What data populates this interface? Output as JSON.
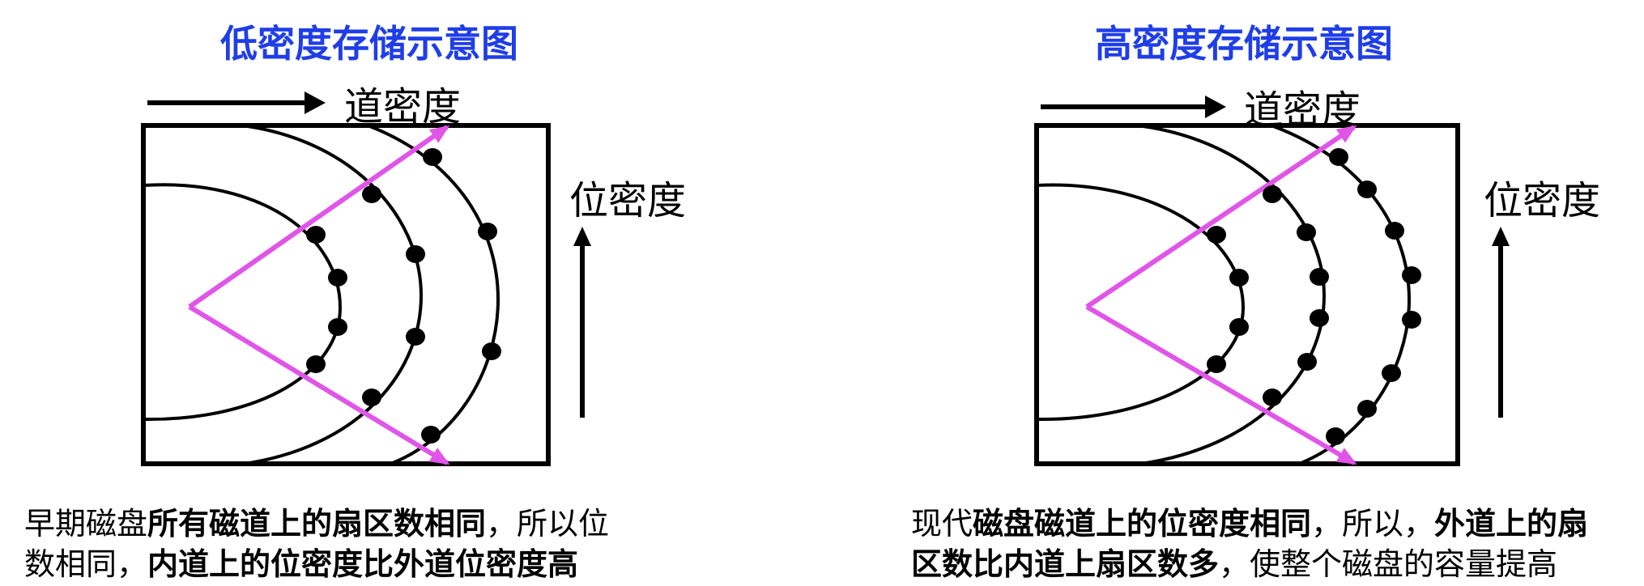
{
  "left": {
    "title": "低密度存储示意图",
    "track_density_label": "道密度",
    "bit_density_label": "位密度",
    "caption": {
      "line1_normal_a": "早期磁盘",
      "line1_bold": "所有磁道上的扇区数相同",
      "line1_normal_b": "，所以位",
      "line2_normal_a": "数相同，",
      "line2_bold": "内道上的位密度比外道位密度高"
    }
  },
  "right": {
    "title": "高密度存储示意图",
    "track_density_label": "道密度",
    "bit_density_label": "位密度",
    "caption": {
      "line1_normal_a": "现代",
      "line1_bold_a": "磁盘磁道上的位密度相同",
      "line1_normal_b": "，所以，",
      "line1_bold_b": "外道上的扇",
      "line2_bold": "区数比内道上扇区数多",
      "line2_normal": "，使整个磁盘的容量提高"
    }
  },
  "colors": {
    "title": "#1f3ee8",
    "sector_arrows": "#e055e8",
    "lines": "#000000"
  }
}
